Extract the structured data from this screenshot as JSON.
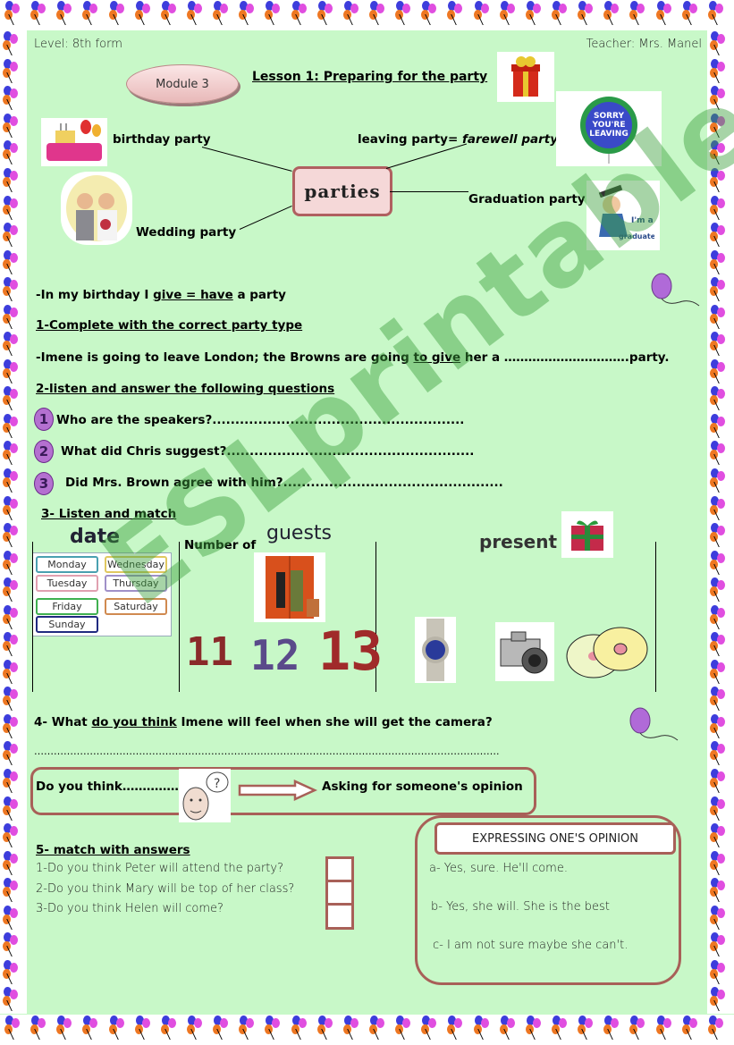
{
  "header": {
    "level": "Level: 8th form",
    "teacher": "Teacher: Mrs.  Manel",
    "module": "Module 3",
    "lesson_title": "Lesson 1: Preparing for the party"
  },
  "mindmap": {
    "center": "parties",
    "birthday": "birthday party",
    "leaving_prefix": "leaving party= ",
    "leaving_italic": "farewell party",
    "wedding": "Wedding party",
    "graduation": "Graduation party",
    "balloon_text": "SORRY YOU'RE LEAVING",
    "grad_text": "I'm a graduate"
  },
  "note": {
    "prefix": "-In my birthday I ",
    "underlined": "give = have",
    "suffix": " a party"
  },
  "exercise1": {
    "title": "1-Complete with the correct party type",
    "text_prefix": "-Imene is going to leave London; the Browns are going ",
    "text_underlined": "to give",
    "text_suffix": " her a ………………………….party."
  },
  "exercise2": {
    "title": "2-listen and answer the following questions",
    "questions": [
      {
        "num": "1",
        "text": "Who are the speakers?......................................................."
      },
      {
        "num": "2",
        "text": "What did Chris suggest?......................................................"
      },
      {
        "num": "3",
        "text": "Did Mrs. Brown agree with him?................................................"
      }
    ]
  },
  "exercise3": {
    "title": "3- Listen and match",
    "date_label": "date",
    "guests_prefix": "Number of ",
    "guests_label": "guests",
    "present_label": "present",
    "days": [
      "Monday",
      "Wednesday",
      "Tuesday",
      "Thursday",
      "Friday",
      "Saturday",
      "Sunday"
    ],
    "numbers": [
      "11",
      "12",
      "13"
    ],
    "presents": [
      "watch",
      "camera",
      "CDs"
    ]
  },
  "exercise4": {
    "prefix": "4- What ",
    "underlined": "do you think",
    "suffix": " Imene will feel when she will get the camera?",
    "answer_line": "…………………………………………………………………………………………………………………………….",
    "box_text": "Do you think…………………",
    "box_meaning": "Asking for someone's opinion"
  },
  "exercise5": {
    "title": "5-  match with answers",
    "questions": [
      "1-Do you think Peter will attend the party?",
      "2-Do you think Mary will be top of her class?",
      "3-Do you think Helen will come?"
    ],
    "answers_title": "EXPRESSING ONE'S OPINION",
    "answers": [
      "a- Yes, sure. He'll come.",
      "b- Yes, she will. She is the best",
      "c- I am not sure maybe she can't."
    ]
  },
  "watermark": "ESLprintables.com"
}
